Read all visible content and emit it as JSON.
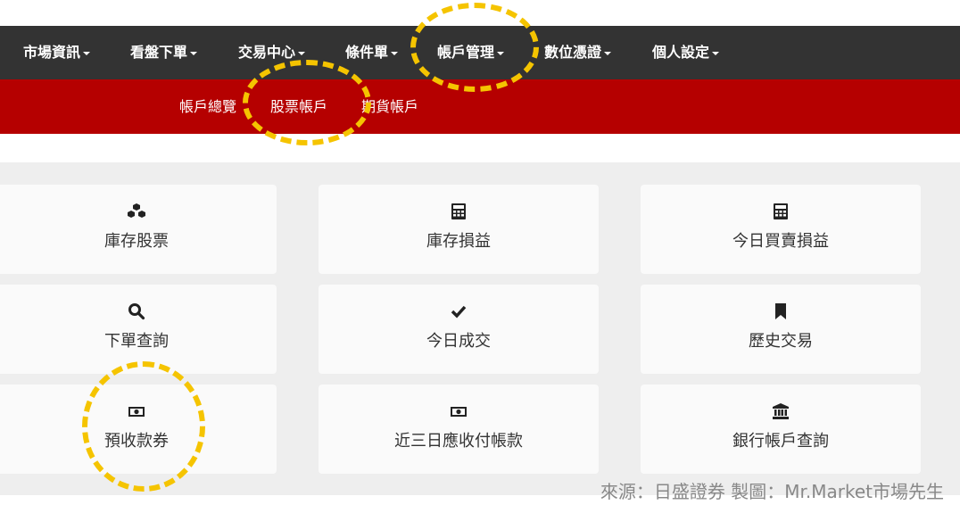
{
  "topnav": {
    "items": [
      {
        "label": "市場資訊"
      },
      {
        "label": "看盤下單"
      },
      {
        "label": "交易中心"
      },
      {
        "label": "條件單"
      },
      {
        "label": "帳戶管理"
      },
      {
        "label": "數位憑證"
      },
      {
        "label": "個人設定"
      }
    ]
  },
  "subnav": {
    "items": [
      {
        "label": "帳戶總覽"
      },
      {
        "label": "股票帳戶"
      },
      {
        "label": "期貨帳戶"
      }
    ]
  },
  "cards": [
    {
      "label": "庫存股票",
      "icon": "cubes-icon"
    },
    {
      "label": "庫存損益",
      "icon": "calculator-icon"
    },
    {
      "label": "今日買賣損益",
      "icon": "calculator-icon"
    },
    {
      "label": "下單查詢",
      "icon": "search-icon"
    },
    {
      "label": "今日成交",
      "icon": "check-icon"
    },
    {
      "label": "歷史交易",
      "icon": "bookmark-icon"
    },
    {
      "label": "預收款券",
      "icon": "money-icon"
    },
    {
      "label": "近三日應收付帳款",
      "icon": "money-icon"
    },
    {
      "label": "銀行帳戶查詢",
      "icon": "bank-icon"
    }
  ],
  "source_text": "來源：日盛證券 製圖：Mr.Market市場先生",
  "colors": {
    "topnav_bg": "#333333",
    "subnav_bg": "#b50000",
    "content_bg": "#eeeeee",
    "card_bg": "#fafafa",
    "highlight": "#f5c400"
  }
}
